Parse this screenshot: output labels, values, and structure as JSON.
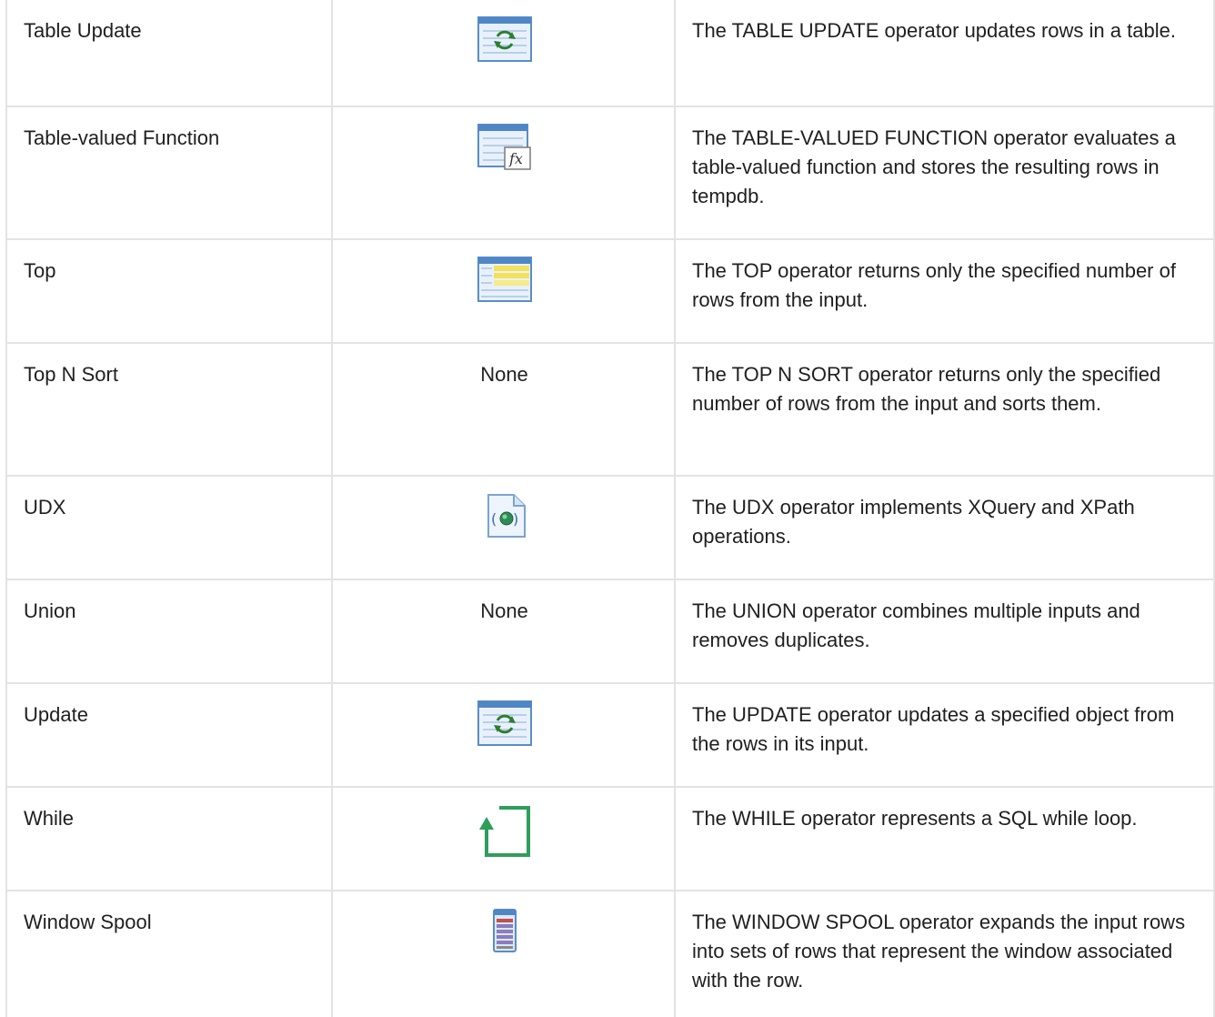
{
  "rows": [
    {
      "name": "Table Update",
      "icon": "table-update-icon",
      "graphical": "",
      "description": "The TABLE UPDATE operator updates rows in a table."
    },
    {
      "name": "Table-valued Function",
      "icon": "table-valued-function-icon",
      "graphical": "",
      "description": "The TABLE-VALUED FUNCTION operator evaluates a table-valued function and stores the resulting rows in tempdb."
    },
    {
      "name": "Top",
      "icon": "top-icon",
      "graphical": "",
      "description": "The TOP operator returns only the specified number of rows from the input."
    },
    {
      "name": "Top N Sort",
      "icon": "",
      "graphical": "None",
      "description": "The TOP N SORT operator returns only the specified number of rows from the input and sorts them."
    },
    {
      "name": "UDX",
      "icon": "udx-icon",
      "graphical": "",
      "description": "The UDX operator implements XQuery and XPath operations."
    },
    {
      "name": "Union",
      "icon": "",
      "graphical": "None",
      "description": "The UNION operator combines multiple inputs and removes duplicates."
    },
    {
      "name": "Update",
      "icon": "update-icon",
      "graphical": "",
      "description": "The UPDATE operator updates a specified object from the rows in its input."
    },
    {
      "name": "While",
      "icon": "while-loop-icon",
      "graphical": "",
      "description": "The WHILE operator represents a SQL while loop."
    },
    {
      "name": "Window Spool",
      "icon": "window-spool-icon",
      "graphical": "",
      "description": "The WINDOW SPOOL operator expands the input rows into sets of rows that represent the window associated with the row."
    }
  ]
}
